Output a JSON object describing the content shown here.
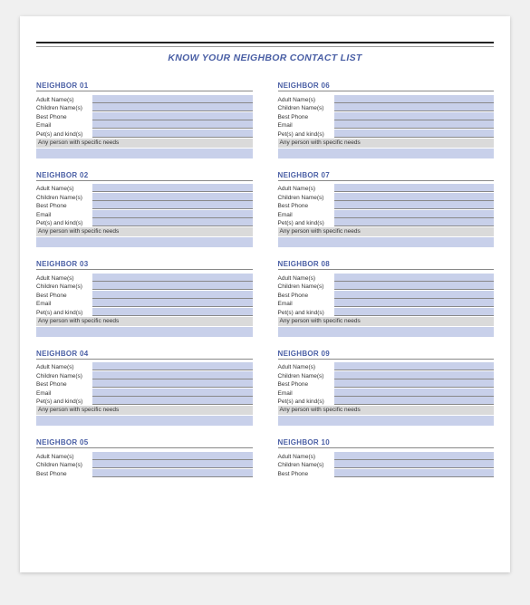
{
  "title": "KNOW YOUR NEIGHBOR CONTACT LIST",
  "field_labels": {
    "adult": "Adult Name(s)",
    "children": "Children Name(s)",
    "phone": "Best Phone",
    "email": "Email",
    "pets": "Pet(s) and kind(s)",
    "needs": "Any person with specific needs"
  },
  "left_column": [
    {
      "header": "NEIGHBOR  01",
      "full": true
    },
    {
      "header": "NEIGHBOR  02",
      "full": true
    },
    {
      "header": "NEIGHBOR  03",
      "full": true
    },
    {
      "header": "NEIGHBOR  04",
      "full": true
    },
    {
      "header": "NEIGHBOR  05",
      "full": false
    }
  ],
  "right_column": [
    {
      "header": "NEIGHBOR  06",
      "full": true
    },
    {
      "header": "NEIGHBOR  07",
      "full": true
    },
    {
      "header": "NEIGHBOR  08",
      "full": true
    },
    {
      "header": "NEIGHBOR  09",
      "full": true
    },
    {
      "header": "NEIGHBOR  10",
      "full": false
    }
  ]
}
